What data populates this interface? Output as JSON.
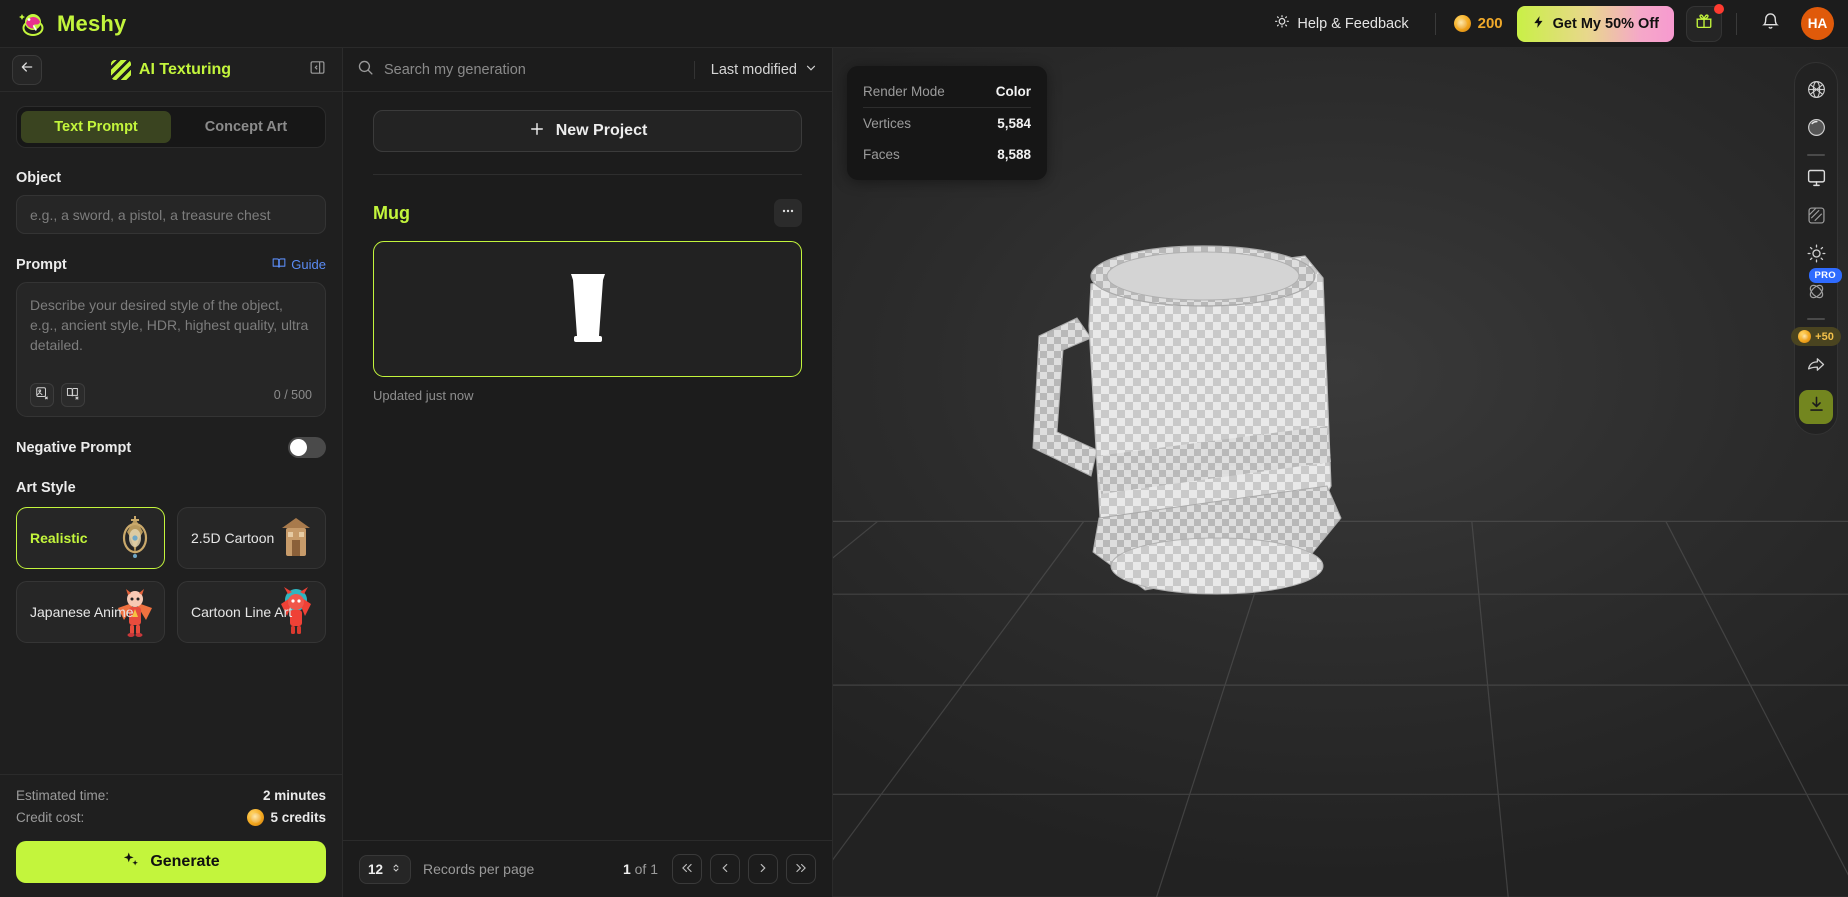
{
  "topbar": {
    "brand_name": "Meshy",
    "brand_logo_icon": "meshy-palette-icon",
    "help_label": "Help & Feedback",
    "help_icon": "lightbulb-icon",
    "credits_value": "200",
    "credits_icon": "coin-icon",
    "promo_label": "Get My 50% Off",
    "promo_icon": "lightning-bolt-icon",
    "gift_icon": "gift-icon",
    "bell_icon": "bell-icon",
    "avatar_initials": "HA"
  },
  "left_panel": {
    "back_icon": "arrow-left-icon",
    "title": "AI Texturing",
    "title_icon": "stripes-icon",
    "collapse_icon": "panel-collapse-icon",
    "tabs": [
      {
        "label": "Text Prompt",
        "active": true
      },
      {
        "label": "Concept Art",
        "active": false
      }
    ],
    "object": {
      "label": "Object",
      "placeholder": "e.g., a sword, a pistol, a treasure chest",
      "value": ""
    },
    "prompt": {
      "label": "Prompt",
      "guide_label": "Guide",
      "guide_icon": "book-open-icon",
      "placeholder": "Describe your desired style of the object, e.g., ancient style, HDR, highest quality, ultra detailed.",
      "value": "",
      "counter": "0 / 500",
      "image_icon": "image-x-icon",
      "book_icon": "book-x-icon"
    },
    "negative_prompt": {
      "label": "Negative Prompt",
      "enabled": false
    },
    "art_style": {
      "label": "Art Style",
      "options": [
        {
          "label": "Realistic",
          "selected": true,
          "thumb": "ornate-lantern-thumb"
        },
        {
          "label": "2.5D Cartoon",
          "selected": false,
          "thumb": "cartoon-building-thumb"
        },
        {
          "label": "Japanese Anime",
          "selected": false,
          "thumb": "anime-demon-thumb"
        },
        {
          "label": "Cartoon Line Art",
          "selected": false,
          "thumb": "lineart-demon-thumb"
        }
      ]
    },
    "footer": {
      "estimated_time_label": "Estimated time:",
      "estimated_time_value": "2 minutes",
      "credit_cost_label": "Credit cost:",
      "credit_cost_value": "5 credits",
      "credit_icon": "coin-icon",
      "generate_label": "Generate",
      "generate_icon": "sparkles-icon"
    }
  },
  "mid_panel": {
    "search": {
      "placeholder": "Search my generation",
      "value": "",
      "icon": "search-icon"
    },
    "sort": {
      "value": "Last modified",
      "icon": "chevron-down-icon"
    },
    "new_project_label": "New Project",
    "new_project_icon": "plus-icon",
    "project": {
      "name": "Mug",
      "menu_icon": "more-horizontal-icon",
      "thumb_icon": "mug-silhouette-thumb",
      "updated": "Updated just now"
    },
    "footer": {
      "records_value": "12",
      "records_label": "Records per page",
      "stepper_icon": "chevron-updown-icon",
      "page_current": "1",
      "page_of": "of",
      "page_total": "1",
      "first_icon": "chevrons-left-icon",
      "prev_icon": "chevron-left-icon",
      "next_icon": "chevron-right-icon",
      "last_icon": "chevrons-right-icon"
    }
  },
  "viewport": {
    "info": {
      "render_mode_label": "Render Mode",
      "render_mode_value": "Color",
      "vertices_label": "Vertices",
      "vertices_value": "5,584",
      "faces_label": "Faces",
      "faces_value": "8,588"
    },
    "toolbar": {
      "items": [
        {
          "icon": "wireframe-sphere-icon",
          "badge": ""
        },
        {
          "icon": "shaded-sphere-icon",
          "badge": ""
        },
        {
          "icon": "monitor-icon",
          "badge": ""
        },
        {
          "icon": "texture-hatch-icon",
          "badge": ""
        },
        {
          "icon": "brightness-sun-icon",
          "badge": ""
        },
        {
          "icon": "physics-atom-icon",
          "badge": "PRO"
        },
        {
          "icon": "share-arrow-icon",
          "badge": ""
        }
      ],
      "credit_badge": "+50",
      "credit_badge_icon": "coin-icon",
      "download_icon": "download-icon"
    },
    "model_name": "mug-3d-model"
  },
  "colors": {
    "accent": "#c3f53c",
    "avatar": "#e05a0a",
    "pro_badge": "#2f6bff",
    "credits_text": "#f0a92a"
  }
}
